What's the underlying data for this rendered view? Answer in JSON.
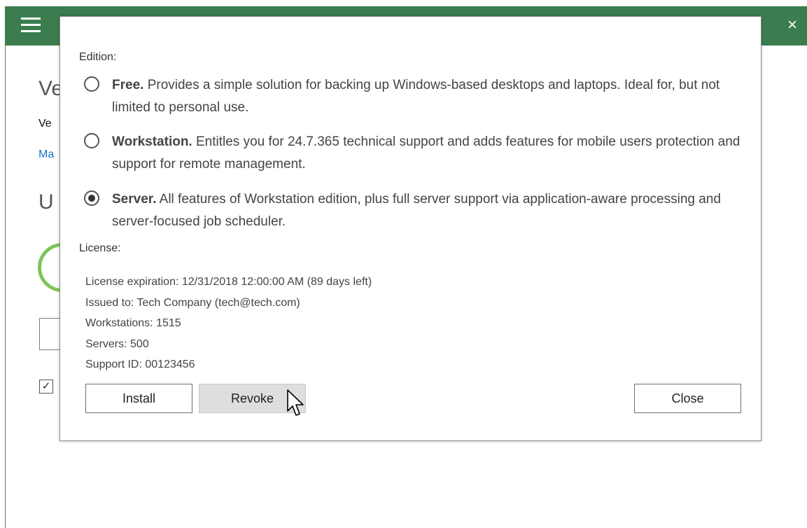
{
  "background": {
    "title_fragment": "Ve",
    "text_fragment": "Ve",
    "link_fragment": "Ma",
    "section_fragment": "U",
    "close_glyph": "×",
    "check_glyph": "✓"
  },
  "dialog": {
    "edition_label": "Edition:",
    "editions": [
      {
        "name": "Free.",
        "description": "Provides a simple solution for backing up Windows-based desktops and laptops. Ideal for, but not limited to personal use.",
        "selected": false
      },
      {
        "name": "Workstation.",
        "description": "Entitles you for 24.7.365 technical support and adds features for mobile users protection and support for remote management.",
        "selected": false
      },
      {
        "name": "Server.",
        "description": "All features of Workstation edition, plus full server support via application-aware processing and server-focused job scheduler.",
        "selected": true
      }
    ],
    "license_label": "License:",
    "license_lines": [
      "License expiration: 12/31/2018 12:00:00 AM (89 days left)",
      "Issued to: Tech Company (tech@tech.com)",
      "Workstations: 1515",
      "Servers: 500",
      "Support ID: 00123456"
    ],
    "buttons": {
      "install": "Install",
      "revoke": "Revoke",
      "close": "Close"
    }
  },
  "colors": {
    "header_green": "#3b7d4f",
    "ring_green": "#7ec459",
    "link_blue": "#1a73c8",
    "hover_gray": "#dedede"
  }
}
